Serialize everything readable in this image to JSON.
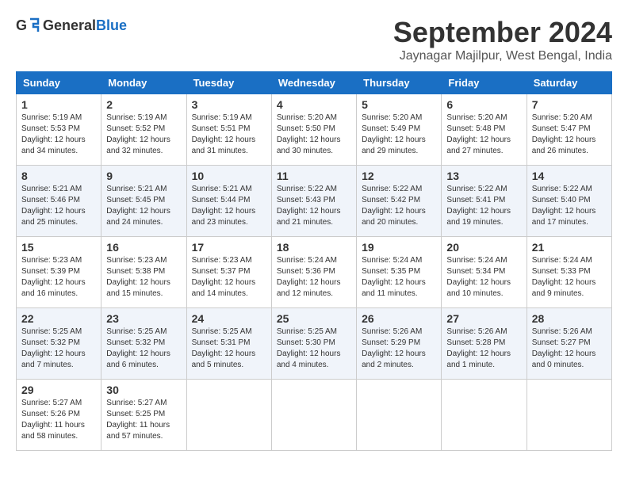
{
  "header": {
    "logo": {
      "text_general": "General",
      "text_blue": "Blue"
    },
    "title": "September 2024",
    "location": "Jaynagar Majilpur, West Bengal, India"
  },
  "weekdays": [
    "Sunday",
    "Monday",
    "Tuesday",
    "Wednesday",
    "Thursday",
    "Friday",
    "Saturday"
  ],
  "weeks": [
    [
      {
        "day": "1",
        "sunrise": "5:19 AM",
        "sunset": "5:53 PM",
        "daylight": "12 hours and 34 minutes."
      },
      {
        "day": "2",
        "sunrise": "5:19 AM",
        "sunset": "5:52 PM",
        "daylight": "12 hours and 32 minutes."
      },
      {
        "day": "3",
        "sunrise": "5:19 AM",
        "sunset": "5:51 PM",
        "daylight": "12 hours and 31 minutes."
      },
      {
        "day": "4",
        "sunrise": "5:20 AM",
        "sunset": "5:50 PM",
        "daylight": "12 hours and 30 minutes."
      },
      {
        "day": "5",
        "sunrise": "5:20 AM",
        "sunset": "5:49 PM",
        "daylight": "12 hours and 29 minutes."
      },
      {
        "day": "6",
        "sunrise": "5:20 AM",
        "sunset": "5:48 PM",
        "daylight": "12 hours and 27 minutes."
      },
      {
        "day": "7",
        "sunrise": "5:20 AM",
        "sunset": "5:47 PM",
        "daylight": "12 hours and 26 minutes."
      }
    ],
    [
      {
        "day": "8",
        "sunrise": "5:21 AM",
        "sunset": "5:46 PM",
        "daylight": "12 hours and 25 minutes."
      },
      {
        "day": "9",
        "sunrise": "5:21 AM",
        "sunset": "5:45 PM",
        "daylight": "12 hours and 24 minutes."
      },
      {
        "day": "10",
        "sunrise": "5:21 AM",
        "sunset": "5:44 PM",
        "daylight": "12 hours and 23 minutes."
      },
      {
        "day": "11",
        "sunrise": "5:22 AM",
        "sunset": "5:43 PM",
        "daylight": "12 hours and 21 minutes."
      },
      {
        "day": "12",
        "sunrise": "5:22 AM",
        "sunset": "5:42 PM",
        "daylight": "12 hours and 20 minutes."
      },
      {
        "day": "13",
        "sunrise": "5:22 AM",
        "sunset": "5:41 PM",
        "daylight": "12 hours and 19 minutes."
      },
      {
        "day": "14",
        "sunrise": "5:22 AM",
        "sunset": "5:40 PM",
        "daylight": "12 hours and 17 minutes."
      }
    ],
    [
      {
        "day": "15",
        "sunrise": "5:23 AM",
        "sunset": "5:39 PM",
        "daylight": "12 hours and 16 minutes."
      },
      {
        "day": "16",
        "sunrise": "5:23 AM",
        "sunset": "5:38 PM",
        "daylight": "12 hours and 15 minutes."
      },
      {
        "day": "17",
        "sunrise": "5:23 AM",
        "sunset": "5:37 PM",
        "daylight": "12 hours and 14 minutes."
      },
      {
        "day": "18",
        "sunrise": "5:24 AM",
        "sunset": "5:36 PM",
        "daylight": "12 hours and 12 minutes."
      },
      {
        "day": "19",
        "sunrise": "5:24 AM",
        "sunset": "5:35 PM",
        "daylight": "12 hours and 11 minutes."
      },
      {
        "day": "20",
        "sunrise": "5:24 AM",
        "sunset": "5:34 PM",
        "daylight": "12 hours and 10 minutes."
      },
      {
        "day": "21",
        "sunrise": "5:24 AM",
        "sunset": "5:33 PM",
        "daylight": "12 hours and 9 minutes."
      }
    ],
    [
      {
        "day": "22",
        "sunrise": "5:25 AM",
        "sunset": "5:32 PM",
        "daylight": "12 hours and 7 minutes."
      },
      {
        "day": "23",
        "sunrise": "5:25 AM",
        "sunset": "5:32 PM",
        "daylight": "12 hours and 6 minutes."
      },
      {
        "day": "24",
        "sunrise": "5:25 AM",
        "sunset": "5:31 PM",
        "daylight": "12 hours and 5 minutes."
      },
      {
        "day": "25",
        "sunrise": "5:25 AM",
        "sunset": "5:30 PM",
        "daylight": "12 hours and 4 minutes."
      },
      {
        "day": "26",
        "sunrise": "5:26 AM",
        "sunset": "5:29 PM",
        "daylight": "12 hours and 2 minutes."
      },
      {
        "day": "27",
        "sunrise": "5:26 AM",
        "sunset": "5:28 PM",
        "daylight": "12 hours and 1 minute."
      },
      {
        "day": "28",
        "sunrise": "5:26 AM",
        "sunset": "5:27 PM",
        "daylight": "12 hours and 0 minutes."
      }
    ],
    [
      {
        "day": "29",
        "sunrise": "5:27 AM",
        "sunset": "5:26 PM",
        "daylight": "11 hours and 58 minutes."
      },
      {
        "day": "30",
        "sunrise": "5:27 AM",
        "sunset": "5:25 PM",
        "daylight": "11 hours and 57 minutes."
      },
      null,
      null,
      null,
      null,
      null
    ]
  ]
}
